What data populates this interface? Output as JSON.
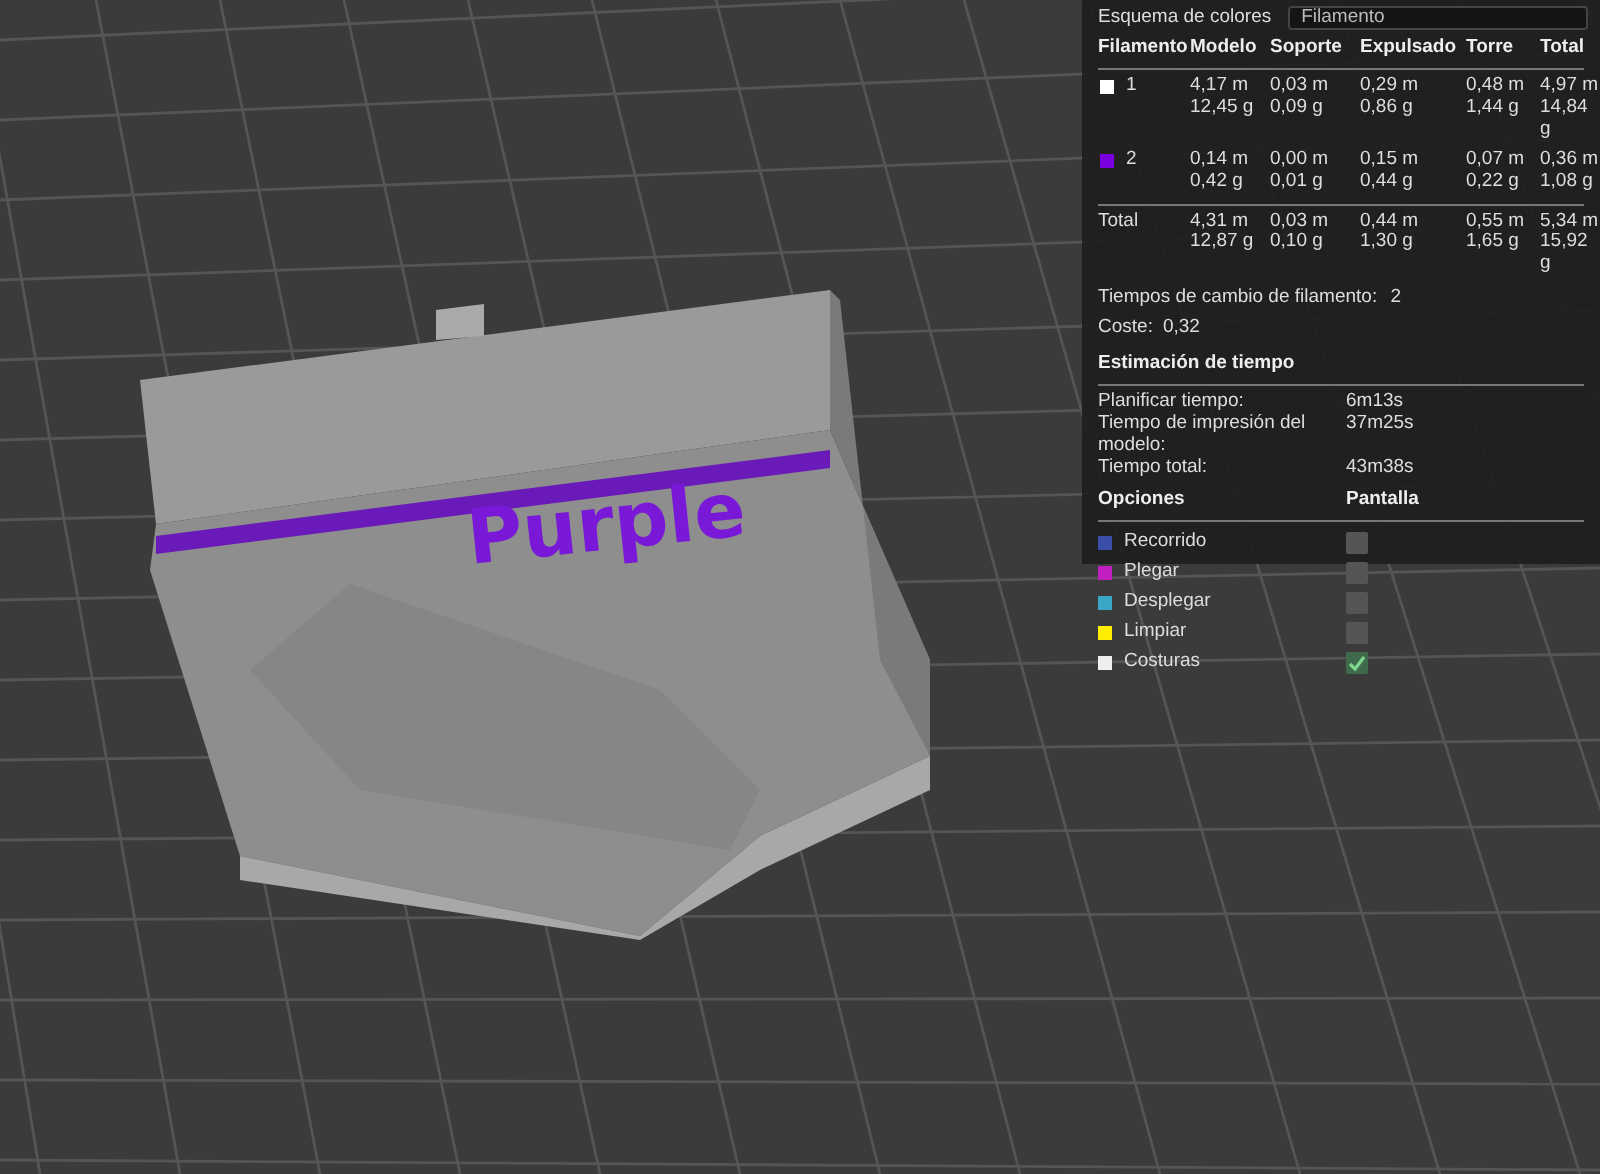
{
  "scene": {
    "model_label": "Purple"
  },
  "panel": {
    "scheme_label": "Esquema de colores",
    "scheme_value": "Filamento",
    "columns": [
      "Filamento",
      "Modelo",
      "Soporte",
      "Expulsado",
      "Torre",
      "Total"
    ],
    "filaments": [
      {
        "name": "1",
        "color": "#ffffff",
        "cells": [
          [
            "4,17 m",
            "12,45 g"
          ],
          [
            "0,03 m",
            "0,09 g"
          ],
          [
            "0,29 m",
            "0,86 g"
          ],
          [
            "0,48 m",
            "1,44 g"
          ],
          [
            "4,97 m",
            "14,84 g"
          ]
        ]
      },
      {
        "name": "2",
        "color": "#7b00e0",
        "cells": [
          [
            "0,14 m",
            "0,42 g"
          ],
          [
            "0,00 m",
            "0,01 g"
          ],
          [
            "0,15 m",
            "0,44 g"
          ],
          [
            "0,07 m",
            "0,22 g"
          ],
          [
            "0,36 m",
            "1,08 g"
          ]
        ]
      }
    ],
    "total": {
      "label": "Total",
      "cells": [
        [
          "4,31 m",
          "12,87 g"
        ],
        [
          "0,03 m",
          "0,10 g"
        ],
        [
          "0,44 m",
          "1,30 g"
        ],
        [
          "0,55 m",
          "1,65 g"
        ],
        [
          "5,34 m",
          "15,92 g"
        ]
      ]
    },
    "changes": {
      "label": "Tiempos de cambio de filamento:",
      "value": "2"
    },
    "cost": {
      "label": "Coste:",
      "value": "0,32"
    },
    "time_title": "Estimación de tiempo",
    "times": [
      {
        "label": "Planificar tiempo:",
        "value": "6m13s"
      },
      {
        "label": "Tiempo de impresión del modelo:",
        "value": "37m25s"
      },
      {
        "label": "Tiempo total:",
        "value": "43m38s"
      }
    ],
    "options_columns": [
      "Opciones",
      "Pantalla"
    ],
    "options": [
      {
        "label": "Recorrido",
        "color": "#3b4fa8",
        "checked": false
      },
      {
        "label": "Plegar",
        "color": "#c21fc0",
        "checked": false
      },
      {
        "label": "Desplegar",
        "color": "#3aa7c9",
        "checked": false
      },
      {
        "label": "Limpiar",
        "color": "#ffee00",
        "checked": false
      },
      {
        "label": "Costuras",
        "color": "#eeeeee",
        "checked": true
      }
    ]
  }
}
